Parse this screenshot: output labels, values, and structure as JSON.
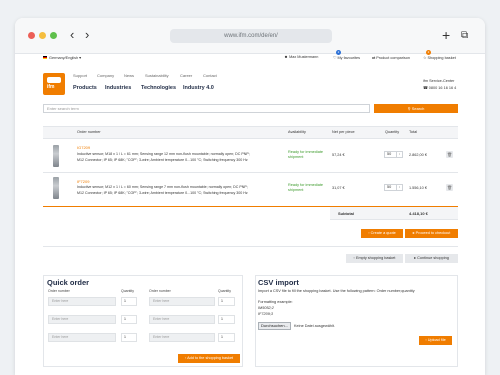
{
  "browser": {
    "url": "www.ifm.com/de/en/",
    "colors": {
      "close": "#ec5f57",
      "minimize": "#f5be3f",
      "maximize": "#5fc04c"
    }
  },
  "header": {
    "locale": "Germany/English",
    "utility": [
      "Max Mustermann",
      "My favourites",
      "Product comparison",
      "Shopping basket"
    ],
    "favourites_badge": "2",
    "basket_badge": "2",
    "logo_text": "ifm",
    "subnav": [
      "Support",
      "Company",
      "News",
      "Sustainability",
      "Career",
      "Contact"
    ],
    "mainnav": [
      "Products",
      "Industries",
      "Technologies",
      "Industry 4.0"
    ],
    "service_title": "ifm Service-Center",
    "service_phone": "0800 16 16 16 4"
  },
  "search": {
    "placeholder": "Enter search term",
    "button": "Search"
  },
  "cart": {
    "columns": [
      "Order number",
      "Availability",
      "Net per piece",
      "Quantity",
      "Total"
    ],
    "items": [
      {
        "order": "IG7209",
        "desc1": "Inductive sensor; M18 x 1 / L = 61 mm; Sensing range 12 mm non-flush mountable; normally open; DC PNP;",
        "desc2": "M12 Connector; IP 65; IP 68K; \"COP\"; 3-wire; Ambient temperature 0...100 °C; Switching frequency 300 Hz",
        "availability": "Ready for immediate shipment",
        "price": "57,24 €",
        "quantity": "50",
        "total": "2.862,00 €"
      },
      {
        "order": "IF7209",
        "desc1": "Inductive sensor; M12 x 1 / L = 60 mm; Sensing range 7 mm non-flush mountable; normally open; DC PNP;",
        "desc2": "M12 Connector; IP 65; IP 68K; \"COP\"; 3-wire; Ambient temperature 0...100 °C; Switching frequency 300 Hz",
        "availability": "Ready for immediate shipment",
        "price": "31,07 €",
        "quantity": "50",
        "total": "1.556,10 €"
      }
    ],
    "subtotal_label": "Subtotal",
    "subtotal": "4.418,10 €"
  },
  "actions": {
    "quote": "Create a quote",
    "checkout": "Proceed to checkout",
    "empty": "Empty shopping basket",
    "continue": "Continue shopping"
  },
  "quick_order": {
    "title": "Quick order",
    "col_order": "Order number",
    "col_qty": "Quantity",
    "placeholder": "Enter here",
    "qty_default": "1",
    "button": "Add to the shopping basket"
  },
  "csv": {
    "title": "CSV import",
    "instructions": "Import a CSV file to fill the shopping basket. Use the following pattern: Order number;quantity",
    "example_label": "Formatting example:",
    "example_1": "IM5052;2",
    "example_2": "IF7209;3",
    "file_button": "Durchsuchen...",
    "file_status": "Keine Datei ausgewählt.",
    "upload": "Upload file"
  }
}
